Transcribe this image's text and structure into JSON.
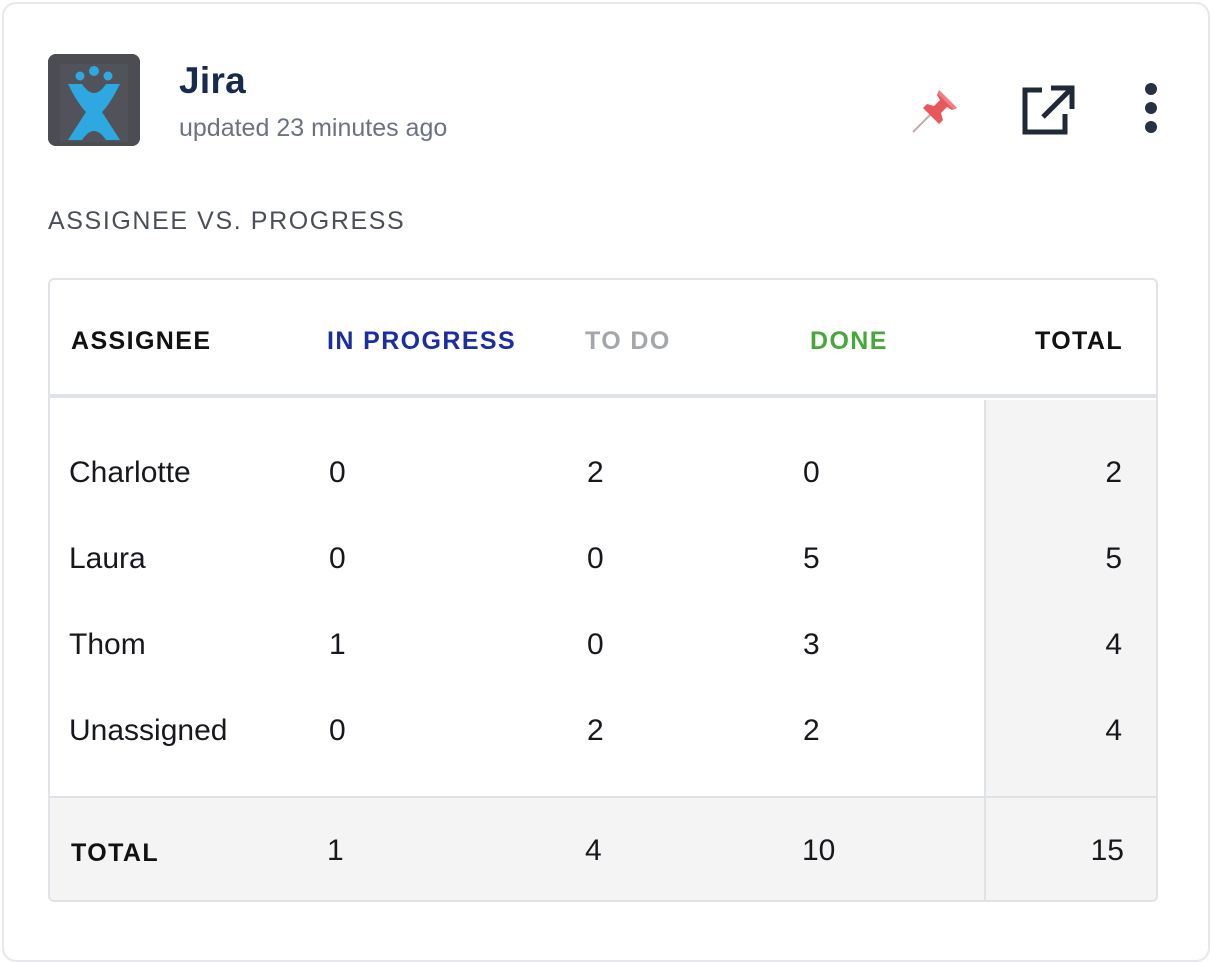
{
  "widget": {
    "app_name": "Jira",
    "updated": "updated 23 minutes ago",
    "icons": {
      "logo": "jira-logo-icon",
      "pin": "pin-icon",
      "open": "open-external-icon",
      "more": "more-vertical-icon"
    },
    "colors": {
      "pin": "#e8585b",
      "in_progress": "#1b2ea0",
      "to_do": "#a3a6ab",
      "done": "#46a83a",
      "logo_bg": "#4b4d52",
      "logo_fg": "#2da8e0"
    }
  },
  "section": {
    "title": "ASSIGNEE VS. PROGRESS"
  },
  "table": {
    "headers": {
      "assignee": "ASSIGNEE",
      "in_progress": "IN PROGRESS",
      "to_do": "TO DO",
      "done": "DONE",
      "total": "TOTAL"
    },
    "rows": [
      {
        "name": "Charlotte",
        "in_progress": "0",
        "to_do": "2",
        "done": "0",
        "total": "2"
      },
      {
        "name": "Laura",
        "in_progress": "0",
        "to_do": "0",
        "done": "5",
        "total": "5"
      },
      {
        "name": "Thom",
        "in_progress": "1",
        "to_do": "0",
        "done": "3",
        "total": "4"
      },
      {
        "name": "Unassigned",
        "in_progress": "0",
        "to_do": "2",
        "done": "2",
        "total": "4"
      }
    ],
    "footer": {
      "label": "TOTAL",
      "in_progress": "1",
      "to_do": "4",
      "done": "10",
      "total": "15"
    }
  }
}
